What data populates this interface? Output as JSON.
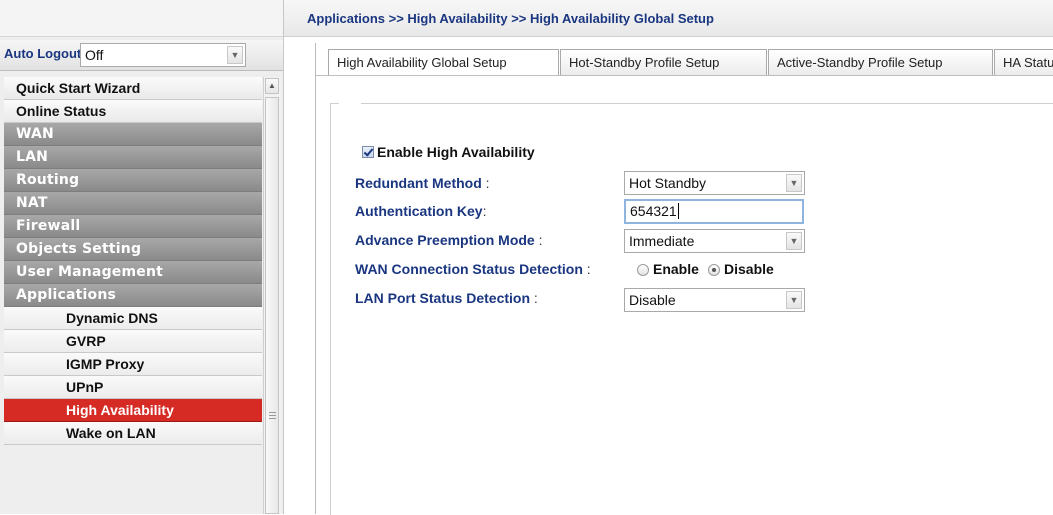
{
  "breadcrumb": "Applications >> High Availability >> High Availability Global Setup",
  "sidebar": {
    "auto_logout_label": "Auto Logout",
    "auto_logout_colon": ":",
    "auto_logout_value": "Off",
    "items": [
      {
        "label": "Quick Start Wizard"
      },
      {
        "label": "Online Status"
      },
      {
        "label": "WAN"
      },
      {
        "label": "LAN"
      },
      {
        "label": "Routing"
      },
      {
        "label": "NAT"
      },
      {
        "label": "Firewall"
      },
      {
        "label": "Objects Setting"
      },
      {
        "label": "User Management"
      },
      {
        "label": "Applications"
      },
      {
        "label": "Dynamic DNS"
      },
      {
        "label": "GVRP"
      },
      {
        "label": "IGMP Proxy"
      },
      {
        "label": "UPnP"
      },
      {
        "label": "High Availability"
      },
      {
        "label": "Wake on LAN"
      }
    ]
  },
  "tabs": [
    {
      "label": "High Availability Global Setup"
    },
    {
      "label": "Hot-Standby Profile Setup"
    },
    {
      "label": "Active-Standby Profile Setup"
    },
    {
      "label": "HA Status"
    }
  ],
  "form": {
    "enable_label": "Enable High Availability",
    "enable_checked": true,
    "colon": ":",
    "redundant_method_label": "Redundant Method",
    "redundant_method_value": "Hot Standby",
    "auth_key_label": "Authentication Key",
    "auth_key_value": "654321",
    "preemption_label": "Advance Preemption Mode",
    "preemption_value": "Immediate",
    "wan_detection_label": "WAN Connection Status Detection",
    "wan_enable_label": "Enable",
    "wan_disable_label": "Disable",
    "wan_selected": "Disable",
    "lan_detection_label": "LAN Port Status Detection",
    "lan_detection_value": "Disable"
  },
  "colors": {
    "label_blue": "#1a3680",
    "active_menu_red": "#d62a24",
    "section_gray": "#959595"
  }
}
